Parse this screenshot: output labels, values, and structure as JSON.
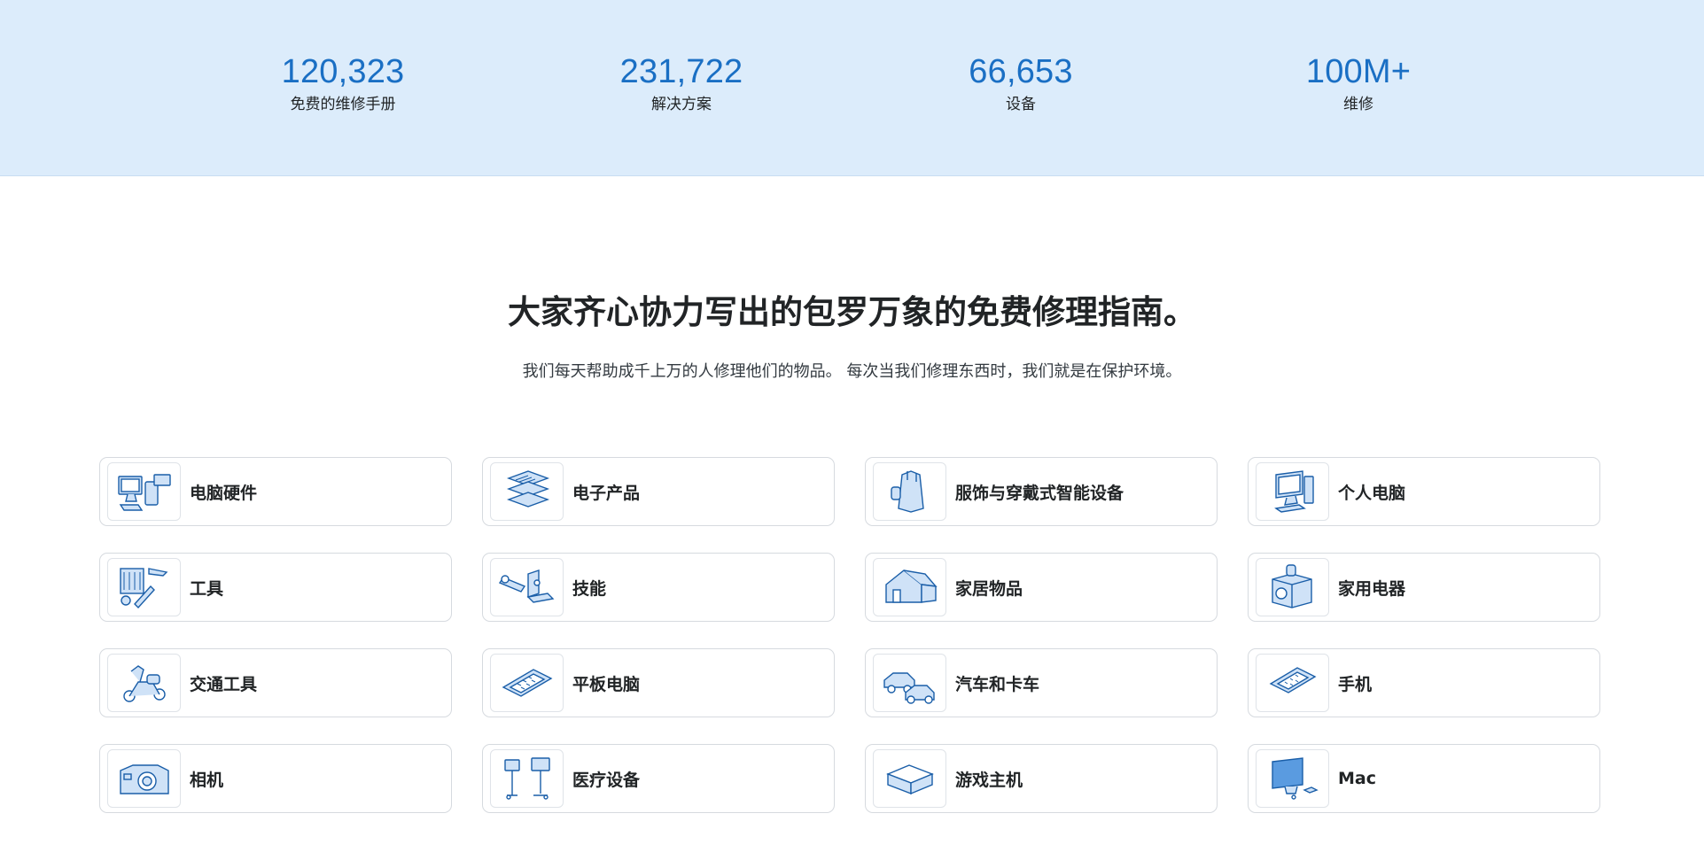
{
  "stats": [
    {
      "value": "120,323",
      "label": "免费的维修手册"
    },
    {
      "value": "231,722",
      "label": "解决方案"
    },
    {
      "value": "66,653",
      "label": "设备"
    },
    {
      "value": "100M+",
      "label": "维修"
    }
  ],
  "hero": {
    "title": "大家齐心协力写出的包罗万象的免费修理指南。",
    "subtitle": "我们每天帮助成千上万的人修理他们的物品。 每次当我们修理东西时，我们就是在保护环境。"
  },
  "categories": [
    {
      "label": "电脑硬件",
      "icon": "computer-hardware-icon"
    },
    {
      "label": "电子产品",
      "icon": "electronics-icon"
    },
    {
      "label": "服饰与穿戴式智能设备",
      "icon": "apparel-wearables-icon"
    },
    {
      "label": "个人电脑",
      "icon": "pc-icon"
    },
    {
      "label": "工具",
      "icon": "tools-icon"
    },
    {
      "label": "技能",
      "icon": "skills-icon"
    },
    {
      "label": "家居物品",
      "icon": "household-icon"
    },
    {
      "label": "家用电器",
      "icon": "appliance-icon"
    },
    {
      "label": "交通工具",
      "icon": "vehicle-icon"
    },
    {
      "label": "平板电脑",
      "icon": "tablet-icon"
    },
    {
      "label": "汽车和卡车",
      "icon": "car-truck-icon"
    },
    {
      "label": "手机",
      "icon": "phone-icon"
    },
    {
      "label": "相机",
      "icon": "camera-icon"
    },
    {
      "label": "医疗设备",
      "icon": "medical-device-icon"
    },
    {
      "label": "游戏主机",
      "icon": "game-console-icon"
    },
    {
      "label": "Mac",
      "icon": "mac-icon"
    }
  ],
  "colors": {
    "accent": "#1a6fc4",
    "banner": "#dcecfb"
  }
}
